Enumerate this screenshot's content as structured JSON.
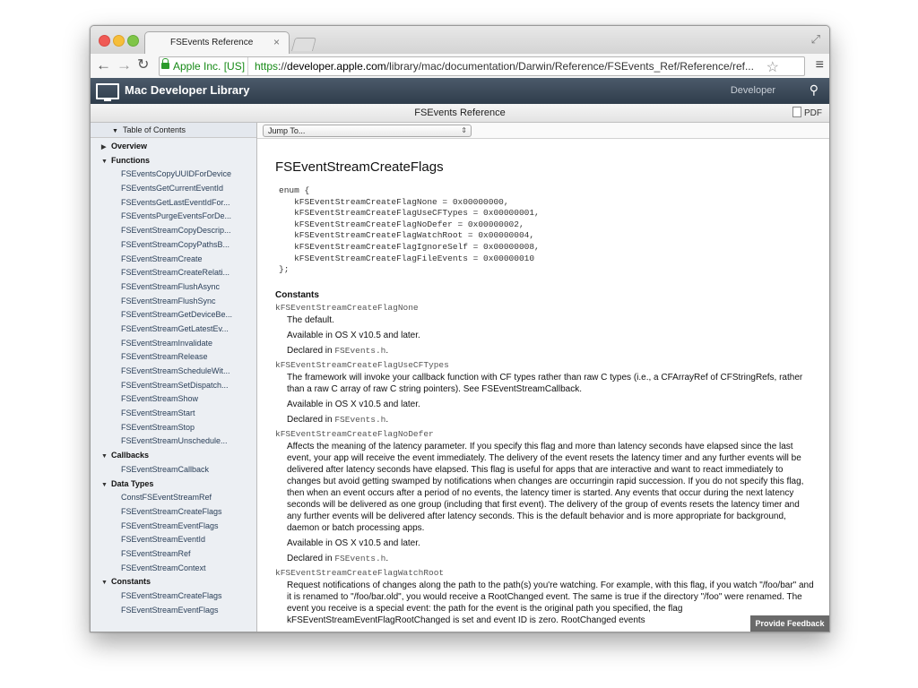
{
  "browser": {
    "tab_title": "FSEvents Reference",
    "tab_close": "×",
    "ev_cert": "Apple Inc. [US]",
    "url_scheme": "https",
    "url_sep": "://",
    "url_host": "developer.apple.com",
    "url_path": "/library/mac/documentation/Darwin/Reference/FSEvents_Ref/Reference/ref..."
  },
  "library": {
    "title": "Mac Developer Library",
    "developer_link": "Developer"
  },
  "docbar": {
    "title": "FSEvents Reference",
    "pdf_label": "PDF"
  },
  "sidebar": {
    "toc_label": "Table of Contents",
    "sections": [
      {
        "label": "Overview",
        "expanded": false,
        "items": []
      },
      {
        "label": "Functions",
        "expanded": true,
        "items": [
          "FSEventsCopyUUIDForDevice",
          "FSEventsGetCurrentEventId",
          "FSEventsGetLastEventIdFor...",
          "FSEventsPurgeEventsForDe...",
          "FSEventStreamCopyDescrip...",
          "FSEventStreamCopyPathsB...",
          "FSEventStreamCreate",
          "FSEventStreamCreateRelati...",
          "FSEventStreamFlushAsync",
          "FSEventStreamFlushSync",
          "FSEventStreamGetDeviceBe...",
          "FSEventStreamGetLatestEv...",
          "FSEventStreamInvalidate",
          "FSEventStreamRelease",
          "FSEventStreamScheduleWit...",
          "FSEventStreamSetDispatch...",
          "FSEventStreamShow",
          "FSEventStreamStart",
          "FSEventStreamStop",
          "FSEventStreamUnschedule..."
        ]
      },
      {
        "label": "Callbacks",
        "expanded": true,
        "items": [
          "FSEventStreamCallback"
        ]
      },
      {
        "label": "Data Types",
        "expanded": true,
        "items": [
          "ConstFSEventStreamRef",
          "FSEventStreamCreateFlags",
          "FSEventStreamEventFlags",
          "FSEventStreamEventId",
          "FSEventStreamRef",
          "FSEventStreamContext"
        ]
      },
      {
        "label": "Constants",
        "expanded": true,
        "items": [
          "FSEventStreamCreateFlags",
          "FSEventStreamEventFlags"
        ]
      }
    ]
  },
  "main": {
    "jump_to": "Jump To...",
    "heading": "FSEventStreamCreateFlags",
    "code": "enum {\n   kFSEventStreamCreateFlagNone = 0x00000000,\n   kFSEventStreamCreateFlagUseCFTypes = 0x00000001,\n   kFSEventStreamCreateFlagNoDefer = 0x00000002,\n   kFSEventStreamCreateFlagWatchRoot = 0x00000004,\n   kFSEventStreamCreateFlagIgnoreSelf = 0x00000008,\n   kFSEventStreamCreateFlagFileEvents = 0x00000010\n};",
    "constants_heading": "Constants",
    "constants": [
      {
        "name": "kFSEventStreamCreateFlagNone",
        "desc": "The default.",
        "available": "Available in OS X v10.5 and later.",
        "declared_prefix": "Declared in ",
        "declared_file": "FSEvents.h",
        "declared_suffix": "."
      },
      {
        "name": "kFSEventStreamCreateFlagUseCFTypes",
        "desc": "The framework will invoke your callback function with CF types rather than raw C types (i.e., a CFArrayRef of CFStringRefs, rather than a raw C array of raw C string pointers). See FSEventStreamCallback.",
        "available": "Available in OS X v10.5 and later.",
        "declared_prefix": "Declared in ",
        "declared_file": "FSEvents.h",
        "declared_suffix": "."
      },
      {
        "name": "kFSEventStreamCreateFlagNoDefer",
        "desc": "Affects the meaning of the latency parameter. If you specify this flag and more than latency seconds have elapsed since the last event, your app will receive the event immediately. The delivery of the event resets the latency timer and any further events will be delivered after latency seconds have elapsed. This flag is useful for apps that are interactive and want to react immediately to changes but avoid getting swamped by notifications when changes are occurringin rapid succession. If you do not specify this flag, then when an event occurs after a period of no events, the latency timer is started. Any events that occur during the next latency seconds will be delivered as one group (including that first event). The delivery of the group of events resets the latency timer and any further events will be delivered after latency seconds. This is the default behavior and is more appropriate for background, daemon or batch processing apps.",
        "available": "Available in OS X v10.5 and later.",
        "declared_prefix": "Declared in ",
        "declared_file": "FSEvents.h",
        "declared_suffix": "."
      },
      {
        "name": "kFSEventStreamCreateFlagWatchRoot",
        "desc": "Request notifications of changes along the path to the path(s) you're watching. For example, with this flag, if you watch \"/foo/bar\" and it is renamed to \"/foo/bar.old\", you would receive a RootChanged event. The same is true if the directory \"/foo\" were renamed. The event you receive is a special event: the path for the event is the original path you specified, the flag kFSEventStreamEventFlagRootChanged is set and event ID is zero. RootChanged events"
      }
    ],
    "feedback_label": "Provide Feedback"
  }
}
